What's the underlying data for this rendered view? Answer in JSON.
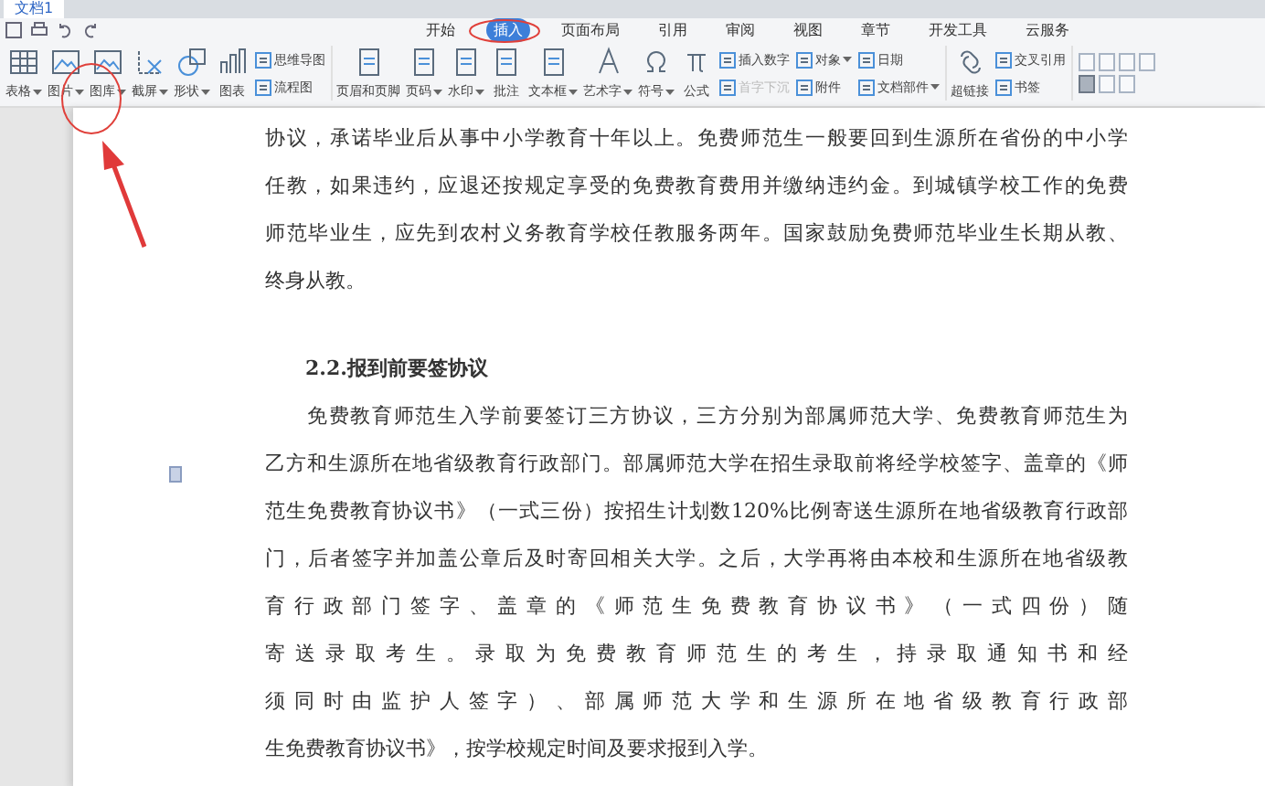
{
  "window": {
    "doc_tab": "文档1"
  },
  "ribbon_tabs": [
    {
      "label": "开始",
      "selected": false
    },
    {
      "label": "插入",
      "selected": true
    },
    {
      "label": "页面布局",
      "selected": false
    },
    {
      "label": "引用",
      "selected": false
    },
    {
      "label": "审阅",
      "selected": false
    },
    {
      "label": "视图",
      "selected": false
    },
    {
      "label": "章节",
      "selected": false
    },
    {
      "label": "开发工具",
      "selected": false
    },
    {
      "label": "云服务",
      "selected": false
    }
  ],
  "ribbon_groups": [
    {
      "items": [
        {
          "kind": "large",
          "label": "表格",
          "dropdown": true
        },
        {
          "kind": "large",
          "label": "图片",
          "dropdown": true
        },
        {
          "kind": "large",
          "label": "图库",
          "dropdown": true
        },
        {
          "kind": "large",
          "label": "截屏",
          "dropdown": true
        },
        {
          "kind": "large",
          "label": "形状",
          "dropdown": true
        },
        {
          "kind": "large",
          "label": "图表",
          "dropdown": false
        },
        {
          "kind": "small",
          "label": "思维导图",
          "dropdown": false,
          "disabled": false
        },
        {
          "kind": "small",
          "label": "流程图",
          "dropdown": false,
          "disabled": false
        }
      ]
    },
    {
      "items": [
        {
          "kind": "large",
          "label": "页眉和页脚",
          "dropdown": false
        },
        {
          "kind": "large",
          "label": "页码",
          "dropdown": true
        },
        {
          "kind": "large",
          "label": "水印",
          "dropdown": true
        },
        {
          "kind": "large",
          "label": "批注",
          "dropdown": false
        },
        {
          "kind": "large",
          "label": "文本框",
          "dropdown": true
        },
        {
          "kind": "large",
          "label": "艺术字",
          "dropdown": true
        },
        {
          "kind": "large",
          "label": "符号",
          "dropdown": true
        },
        {
          "kind": "large",
          "label": "公式",
          "dropdown": false
        },
        {
          "kind": "small",
          "label": "插入数字",
          "dropdown": false,
          "disabled": false
        },
        {
          "kind": "small",
          "label": "首字下沉",
          "dropdown": false,
          "disabled": true
        },
        {
          "kind": "small",
          "label": "对象",
          "dropdown": true,
          "disabled": false
        },
        {
          "kind": "small",
          "label": "附件",
          "dropdown": false,
          "disabled": false
        },
        {
          "kind": "small",
          "label": "日期",
          "dropdown": false,
          "disabled": false
        },
        {
          "kind": "small",
          "label": "文档部件",
          "dropdown": true,
          "disabled": false
        }
      ]
    },
    {
      "items": [
        {
          "kind": "large",
          "label": "超链接",
          "dropdown": false
        },
        {
          "kind": "small",
          "label": "交叉引用",
          "dropdown": false,
          "disabled": false
        },
        {
          "kind": "small",
          "label": "书签",
          "dropdown": false,
          "disabled": false
        }
      ]
    }
  ],
  "layout_buttons": [
    {
      "selected": false
    },
    {
      "selected": false
    },
    {
      "selected": false
    },
    {
      "selected": false
    },
    {
      "selected": true
    },
    {
      "selected": false
    },
    {
      "selected": false
    }
  ],
  "document": [
    {
      "kind": "paragraph",
      "indent": false,
      "lines": [
        "协议，承诺毕业后从事中小学教育十年以上。免费师范生一般要回到生源所在省份的中小学",
        "任教，如果违约，应退还按规定享受的免费教育费用并缴纳违约金。到城镇学校工作的免费",
        "师范毕业生，应先到农村义务教育学校任教服务两年。国家鼓励免费师范毕业生长期从教、",
        "终身从教。"
      ]
    },
    {
      "kind": "heading",
      "text": "2.2.报到前要签协议"
    },
    {
      "kind": "paragraph",
      "indent": true,
      "lines": [
        "免费教育师范生入学前要签订三方协议，三方分别为部属师范大学、免费教育师范生为",
        "乙方和生源所在地省级教育行政部门。部属师范大学在招生录取前将经学校签字、盖章的《师",
        "范生免费教育协议书》（一式三份）按招生计划数120%比例寄送生源所在地省级教育行政部",
        "门，后者签字并加盖公章后及时寄回相关大学。之后，大学再将由本校和生源所在地省级教",
        "育行政部门签字、盖章的《师范生免费教育协议书》（一式四份）随",
        "寄送录取考生。录取为免费教育师范生的考生，持录取通知书和经",
        "须同时由监护人签字）、部属师范大学和生源所在地省级教育行政部",
        "生免费教育协议书》，按学校规定时间及要求报到入学。"
      ]
    }
  ]
}
